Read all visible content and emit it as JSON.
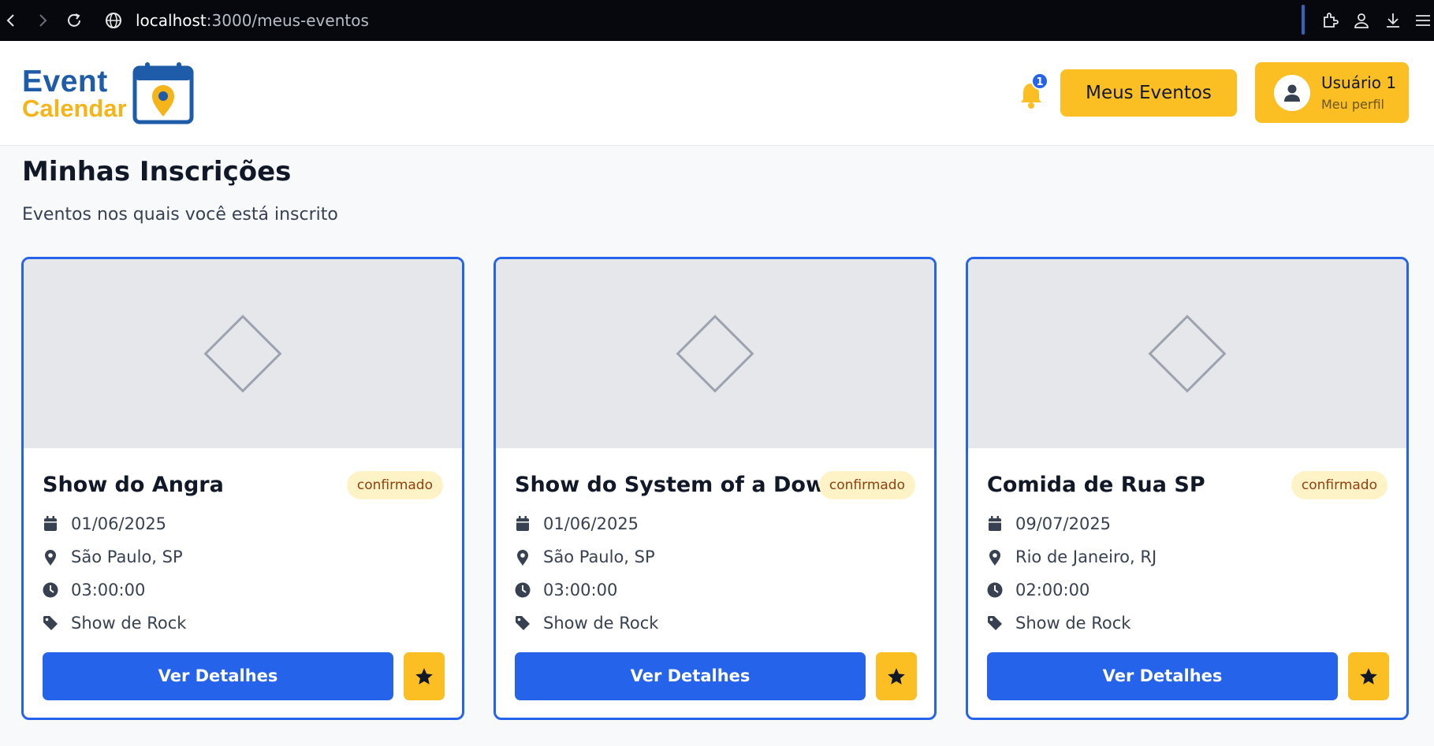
{
  "browser": {
    "url_host": "localhost",
    "url_path": ":3000/meus-eventos"
  },
  "header": {
    "logo_line1": "Event",
    "logo_line2": "Calendar",
    "notification_count": "1",
    "meus_eventos_label": "Meus Eventos",
    "user_name": "Usuário 1",
    "user_sub": "Meu perfil"
  },
  "page": {
    "title": "Minhas Inscrições",
    "subtitle": "Eventos nos quais você está inscrito"
  },
  "cards": [
    {
      "title": "Show do Angra",
      "status": "confirmado",
      "date": "01/06/2025",
      "location": "São Paulo, SP",
      "time": "03:00:00",
      "category": "Show de Rock",
      "button": "Ver Detalhes"
    },
    {
      "title": "Show do System of a Down",
      "status": "confirmado",
      "date": "01/06/2025",
      "location": "São Paulo, SP",
      "time": "03:00:00",
      "category": "Show de Rock",
      "button": "Ver Detalhes"
    },
    {
      "title": "Comida de Rua SP",
      "status": "confirmado",
      "date": "09/07/2025",
      "location": "Rio de Janeiro, RJ",
      "time": "02:00:00",
      "category": "Show de Rock",
      "button": "Ver Detalhes"
    }
  ],
  "colors": {
    "primary": "#2563eb",
    "accent": "#fbbf24",
    "logo_blue": "#1e5ba8",
    "logo_yellow": "#f4b41a"
  },
  "icons": [
    "back-icon",
    "forward-icon",
    "reload-icon",
    "globe-icon",
    "extensions-icon",
    "profile-icon",
    "download-icon",
    "menu-icon",
    "bell-icon",
    "user-icon",
    "calendar-icon",
    "map-pin-icon",
    "clock-icon",
    "tag-icon",
    "star-icon",
    "image-placeholder-icon"
  ]
}
